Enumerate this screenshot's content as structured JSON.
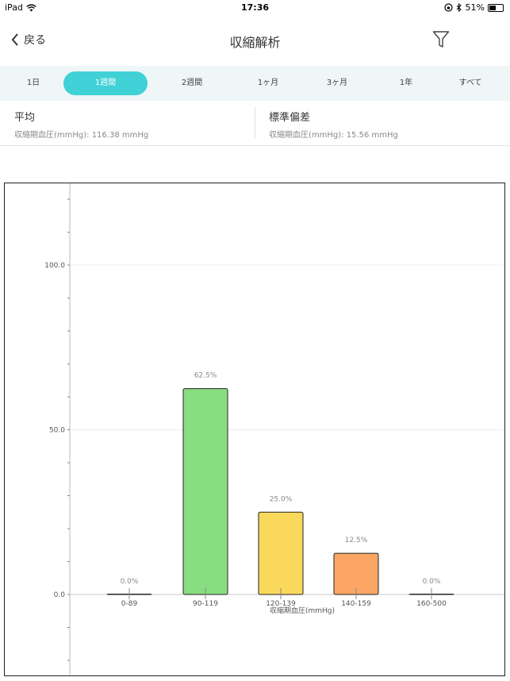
{
  "status_bar": {
    "device": "iPad",
    "time": "17:36",
    "battery_percent": "51%",
    "battery_level": 0.51
  },
  "nav": {
    "back_label": "戻る",
    "title": "収縮解析"
  },
  "tabs": [
    {
      "label": "1日",
      "active": false
    },
    {
      "label": "1週間",
      "active": true
    },
    {
      "label": "2週間",
      "active": false
    },
    {
      "label": "1ヶ月",
      "active": false
    },
    {
      "label": "3ヶ月",
      "active": false
    },
    {
      "label": "1年",
      "active": false
    },
    {
      "label": "すべて",
      "active": false
    }
  ],
  "stats": {
    "average": {
      "title": "平均",
      "value": "収縮期血圧(mmHg): 116.38 mmHg"
    },
    "std_dev": {
      "title": "標準偏差",
      "value": "収縮期血圧(mmHg): 15.56 mmHg"
    }
  },
  "colors": {
    "accent": "#3fd1d6",
    "bar_green": "#88dd80",
    "bar_yellow": "#fad85c",
    "bar_orange": "#fba664"
  },
  "chart_data": {
    "type": "bar",
    "categories": [
      "0-89",
      "90-119",
      "120-139",
      "140-159",
      "160-500"
    ],
    "values": [
      0.0,
      62.5,
      25.0,
      12.5,
      0.0
    ],
    "value_labels": [
      "0.0%",
      "62.5%",
      "25.0%",
      "12.5%",
      "0.0%"
    ],
    "bar_colors": [
      "#ffffff",
      "#88dd80",
      "#fad85c",
      "#fba664",
      "#ffffff"
    ],
    "xlabel": "収縮期血圧(mmHg)",
    "ylabel": "",
    "yticks": [
      "0.0",
      "50.0",
      "100.0"
    ],
    "ylim": [
      -20,
      120
    ],
    "grid": true
  }
}
